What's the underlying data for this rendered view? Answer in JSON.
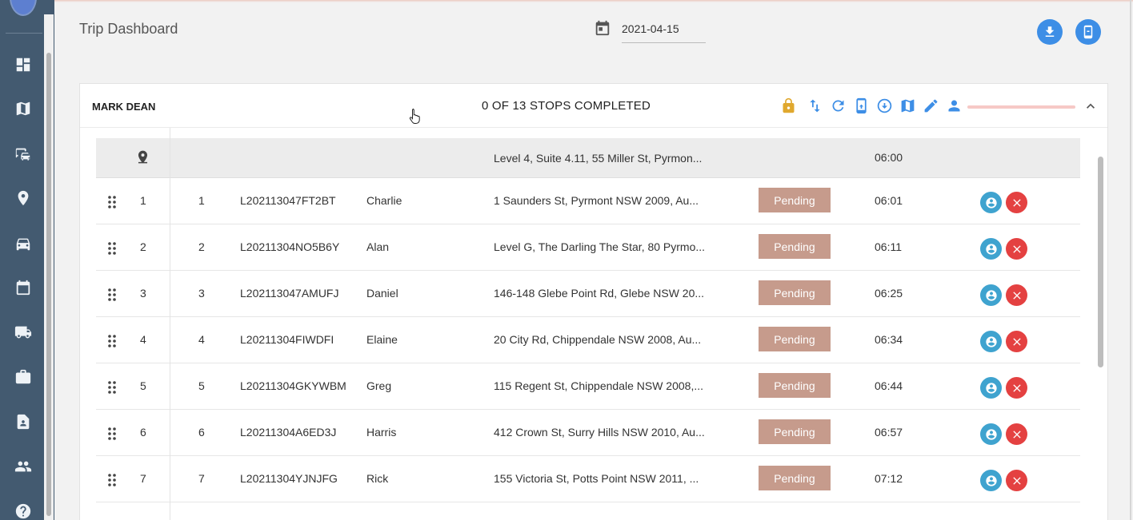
{
  "sidebar": {
    "items": [
      {
        "name": "dashboard",
        "icon": "dashboard-icon"
      },
      {
        "name": "map",
        "icon": "map-icon"
      },
      {
        "name": "transport",
        "icon": "bus-car-icon"
      },
      {
        "name": "locations",
        "icon": "location-pin-icon"
      },
      {
        "name": "vehicles",
        "icon": "car-icon"
      },
      {
        "name": "calendar",
        "icon": "calendar-icon"
      },
      {
        "name": "trucks",
        "icon": "truck-icon"
      },
      {
        "name": "jobs",
        "icon": "briefcase-icon"
      },
      {
        "name": "reports",
        "icon": "contact-page-icon"
      },
      {
        "name": "people",
        "icon": "people-icon"
      },
      {
        "name": "help",
        "icon": "help-icon"
      }
    ]
  },
  "header": {
    "title": "Trip Dashboard",
    "date": "2021-04-15",
    "actions": [
      {
        "name": "download",
        "icon": "download-icon"
      },
      {
        "name": "mobile",
        "icon": "mobile-icon"
      }
    ]
  },
  "trip": {
    "driver": "MARK DEAN",
    "stops_summary": "0 OF 13 STOPS COMPLETED",
    "progress": 0,
    "toolbar_icons": [
      "lock-icon",
      "swap-vertical-icon",
      "refresh-icon",
      "mobile-send-icon",
      "download-circle-icon",
      "map-icon",
      "edit-pencil-icon",
      "person-icon",
      "chevron-up-icon"
    ],
    "start": {
      "address": "Level 4, Suite 4.11, 55 Miller St, Pyrmon...",
      "time": "06:00"
    },
    "stops": [
      {
        "seq": "1",
        "num": "1",
        "id": "L202113047FT2BT",
        "name": "Charlie",
        "address": "1 Saunders St, Pyrmont NSW 2009, Au...",
        "status": "Pending",
        "time": "06:01"
      },
      {
        "seq": "2",
        "num": "2",
        "id": "L20211304NO5B6Y",
        "name": "Alan",
        "address": "Level G, The Darling The Star, 80 Pyrmo...",
        "status": "Pending",
        "time": "06:11"
      },
      {
        "seq": "3",
        "num": "3",
        "id": "L202113047AMUFJ",
        "name": "Daniel",
        "address": "146-148 Glebe Point Rd, Glebe NSW 20...",
        "status": "Pending",
        "time": "06:25"
      },
      {
        "seq": "4",
        "num": "4",
        "id": "L20211304FIWDFI",
        "name": "Elaine",
        "address": "20 City Rd, Chippendale NSW 2008, Au...",
        "status": "Pending",
        "time": "06:34"
      },
      {
        "seq": "5",
        "num": "5",
        "id": "L20211304GKYWBM",
        "name": "Greg",
        "address": "115 Regent St, Chippendale NSW 2008,...",
        "status": "Pending",
        "time": "06:44"
      },
      {
        "seq": "6",
        "num": "6",
        "id": "L20211304A6ED3J",
        "name": "Harris",
        "address": "412 Crown St, Surry Hills NSW 2010, Au...",
        "status": "Pending",
        "time": "06:57"
      },
      {
        "seq": "7",
        "num": "7",
        "id": "L20211304YJNJFG",
        "name": "Rick",
        "address": "155 Victoria St, Potts Point NSW 2011, ...",
        "status": "Pending",
        "time": "07:12"
      }
    ]
  },
  "colors": {
    "sidebar": "#435a70",
    "accent": "#3d8ee6",
    "pending_badge": "#c69b8c",
    "lock": "#e0a82e",
    "assign": "#3fa3cf",
    "remove": "#e44141"
  }
}
